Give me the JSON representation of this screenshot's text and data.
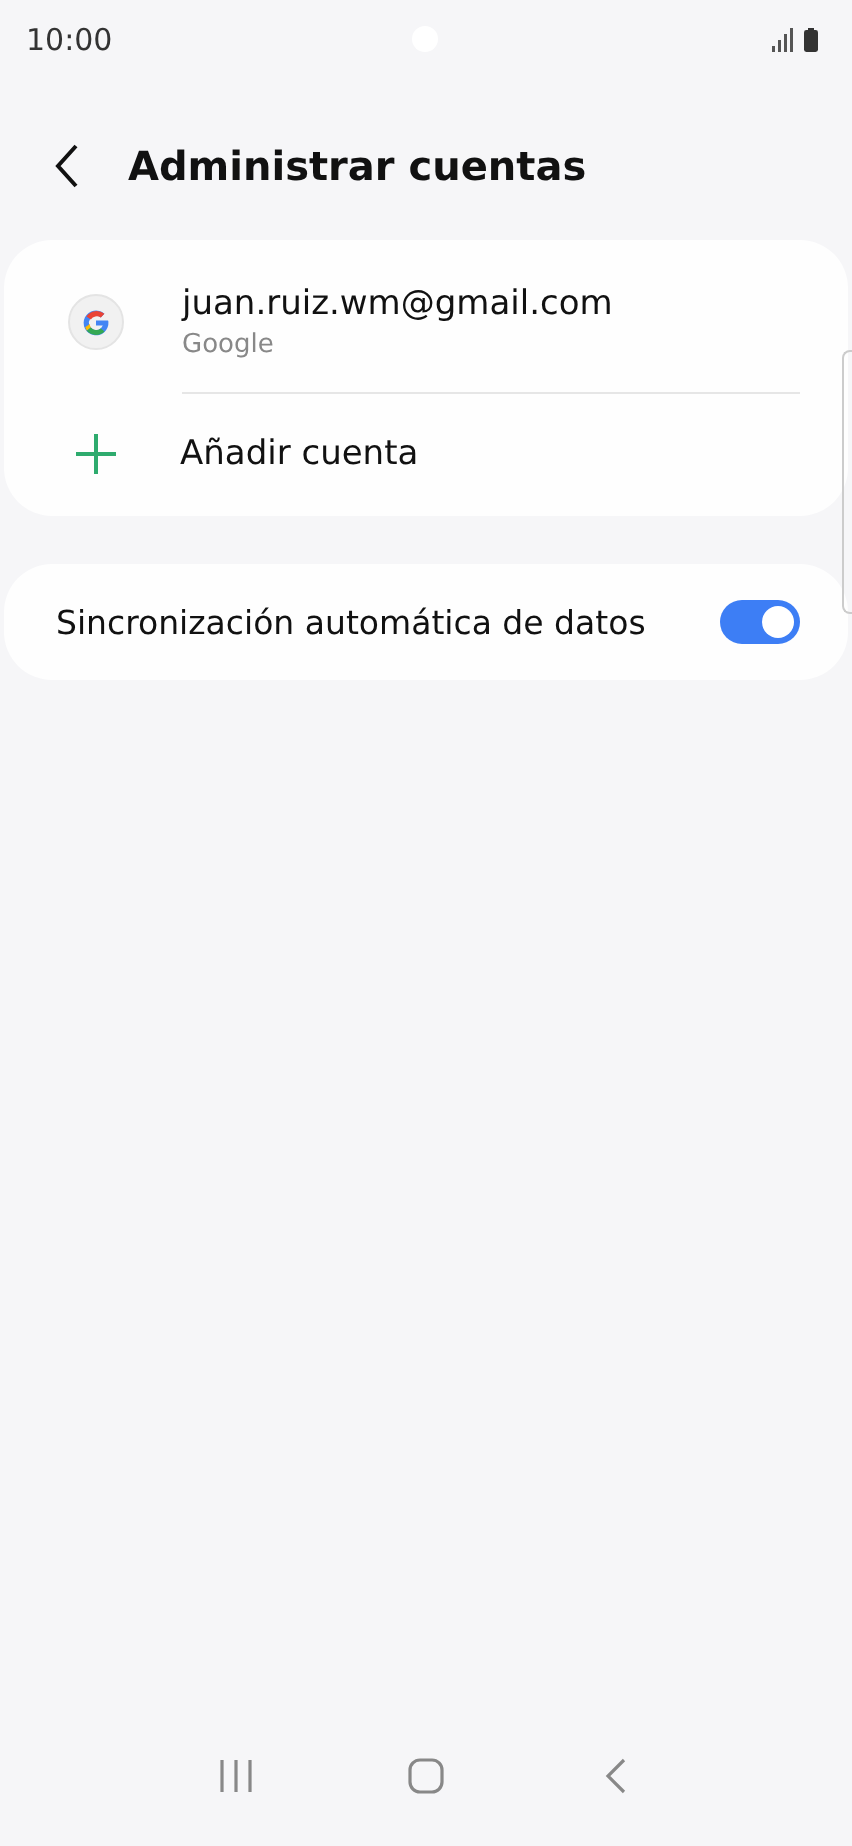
{
  "status_bar": {
    "time": "10:00"
  },
  "header": {
    "title": "Administrar cuentas"
  },
  "accounts": [
    {
      "email": "juan.ruiz.wm@gmail.com",
      "provider": "Google"
    }
  ],
  "add_account": {
    "label": "Añadir cuenta"
  },
  "settings": [
    {
      "label": "Sincronización automática de datos",
      "on": true
    }
  ]
}
